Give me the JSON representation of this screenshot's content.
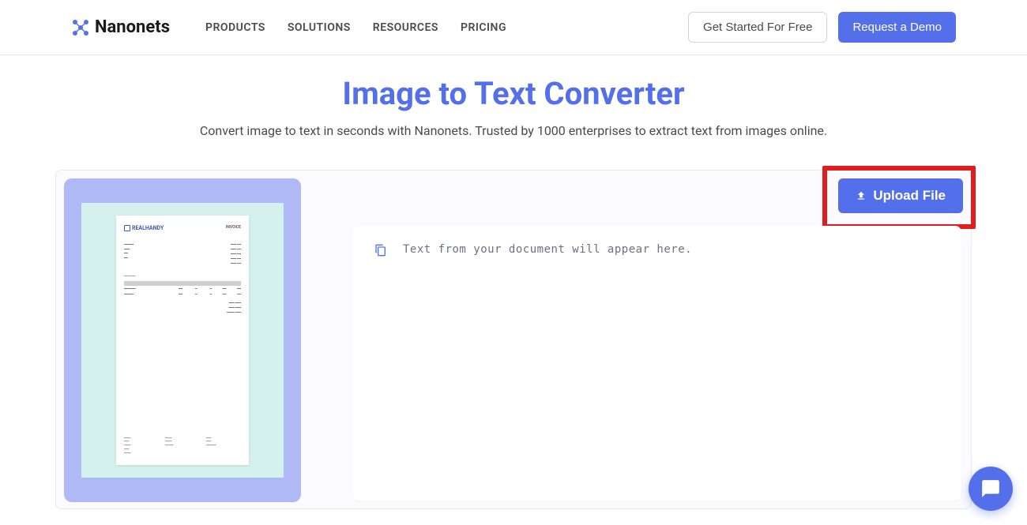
{
  "brand": {
    "name": "Nanonets"
  },
  "nav": {
    "products": "PRODUCTS",
    "solutions": "SOLUTIONS",
    "resources": "RESOURCES",
    "pricing": "PRICING"
  },
  "header_cta": {
    "free": "Get Started For Free",
    "demo": "Request a Demo"
  },
  "hero": {
    "title": "Image to Text Converter",
    "subtitle": "Convert image to text in seconds with Nanonets. Trusted by 1000 enterprises to extract text from images online."
  },
  "upload": {
    "label": "Upload File"
  },
  "output": {
    "placeholder": "Text from your document will appear here."
  },
  "sample_doc": {
    "brand": "REALHANDY",
    "label": "INVOICE"
  },
  "colors": {
    "accent": "#546fea",
    "highlight": "#e11d1d"
  }
}
